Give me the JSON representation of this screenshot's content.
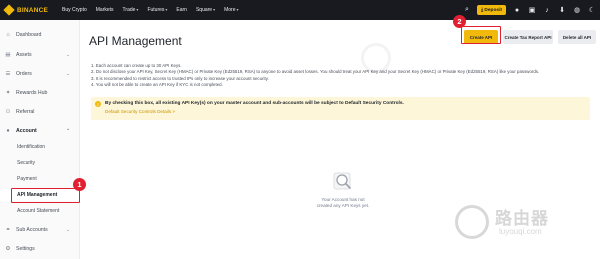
{
  "topbar": {
    "brand": "BINANCE",
    "nav": [
      {
        "label": "Buy Crypto",
        "caret": false
      },
      {
        "label": "Markets",
        "caret": false
      },
      {
        "label": "Trade",
        "caret": true
      },
      {
        "label": "Futures",
        "caret": true
      },
      {
        "label": "Earn",
        "caret": false
      },
      {
        "label": "Square",
        "caret": true
      },
      {
        "label": "More",
        "caret": true
      }
    ],
    "deposit_label": "Deposit",
    "icons": [
      "search-icon",
      "wallet-icon",
      "user-icon",
      "notification-icon",
      "download-icon",
      "globe-icon",
      "theme-icon"
    ]
  },
  "sidebar": {
    "items": [
      {
        "label": "Dashboard",
        "icon": "home-icon"
      },
      {
        "label": "Assets",
        "icon": "wallet-icon"
      },
      {
        "label": "Orders",
        "icon": "orders-icon"
      },
      {
        "label": "Rewards Hub",
        "icon": "gift-icon"
      },
      {
        "label": "Referral",
        "icon": "referral-icon"
      },
      {
        "label": "Account",
        "icon": "user-icon"
      },
      {
        "label": "Identification"
      },
      {
        "label": "Security"
      },
      {
        "label": "Payment"
      },
      {
        "label": "API Management"
      },
      {
        "label": "Account Statement"
      },
      {
        "label": "Sub Accounts",
        "icon": "sub-accounts-icon"
      },
      {
        "label": "Settings",
        "icon": "settings-icon"
      }
    ]
  },
  "main": {
    "title": "API Management",
    "buttons": {
      "create": "Create API",
      "report": "Create Tax Report API",
      "delete": "Delete all API"
    },
    "rules": [
      "1. Each account can create up to 30 API Keys.",
      "2. Do not disclose your API Key, Secret Key (HMAC) or Private Key (Ed25519, RSA) to anyone to avoid asset losses. You should treat your API Key and your Secret Key (HMAC) or Private Key (Ed25519, RSA) like your passwords.",
      "3. It is recommended to restrict access to trusted IPs only to increase your account security.",
      "4. You will not be able to create an API Key if KYC is not completed."
    ],
    "notice": {
      "text": "By checking this box, all existing API Key(s) on your master account and sub-accounts will be subject to Default Security Controls.",
      "link": "Default Security Controls Details >"
    },
    "empty": {
      "line1": "Your Account has not",
      "line2": "created any API Keys yet."
    }
  },
  "annotations": {
    "step1": "1",
    "step2": "2"
  },
  "watermark": {
    "text": "路由器",
    "sub": "luyouqi.com"
  },
  "colors": {
    "brand": "#f0b90b",
    "topbar_bg": "#181a20",
    "highlight": "#e02030",
    "notice_bg": "#fef6d8"
  }
}
